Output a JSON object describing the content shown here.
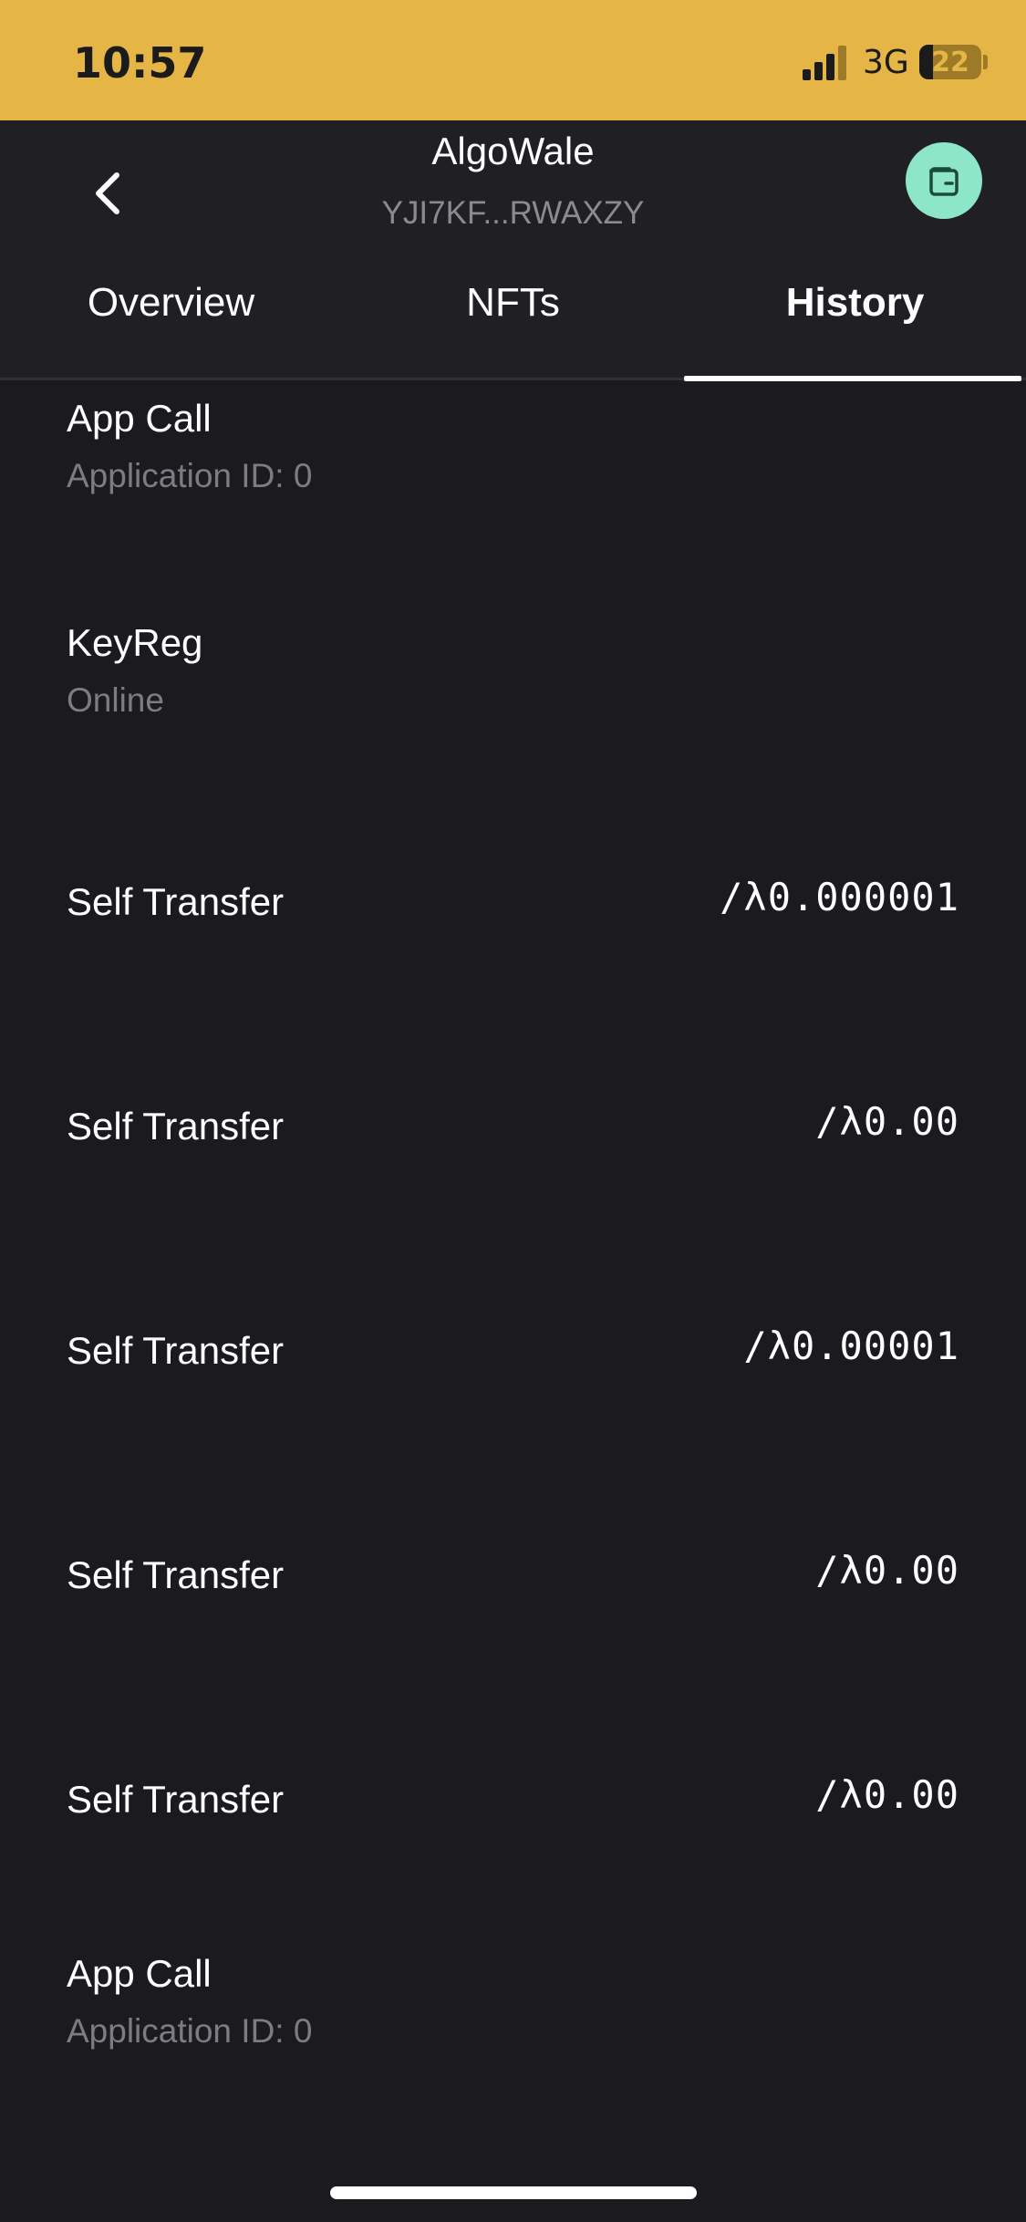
{
  "status_bar": {
    "time": "10:57",
    "network": "3G",
    "battery": "22",
    "battery_level": 0.22
  },
  "header": {
    "title": "AlgoWale",
    "address": "YJI7KF...RWAXZY",
    "back_icon": "chevron-left-icon",
    "wallet_icon": "wallet-icon",
    "wallet_button_color": "#8ee6c9"
  },
  "tabs": [
    {
      "label": "Overview",
      "active": false
    },
    {
      "label": "NFTs",
      "active": false
    },
    {
      "label": "History",
      "active": true
    }
  ],
  "history": [
    {
      "title": "App Call",
      "subtitle": "Application ID: 0",
      "amount": ""
    },
    {
      "title": "KeyReg",
      "subtitle": "Online",
      "amount": ""
    },
    {
      "title": "Self Transfer",
      "subtitle": "",
      "amount": "0.000001"
    },
    {
      "title": "Self Transfer",
      "subtitle": "",
      "amount": "0.00"
    },
    {
      "title": "Self Transfer",
      "subtitle": "",
      "amount": "0.00001"
    },
    {
      "title": "Self Transfer",
      "subtitle": "",
      "amount": "0.00"
    },
    {
      "title": "Self Transfer",
      "subtitle": "",
      "amount": "0.00"
    },
    {
      "title": "App Call",
      "subtitle": "Application ID: 0",
      "amount": ""
    }
  ],
  "colors": {
    "status_bar": "#e5b546",
    "background": "#1a1a1f",
    "header": "#1f1f24"
  }
}
